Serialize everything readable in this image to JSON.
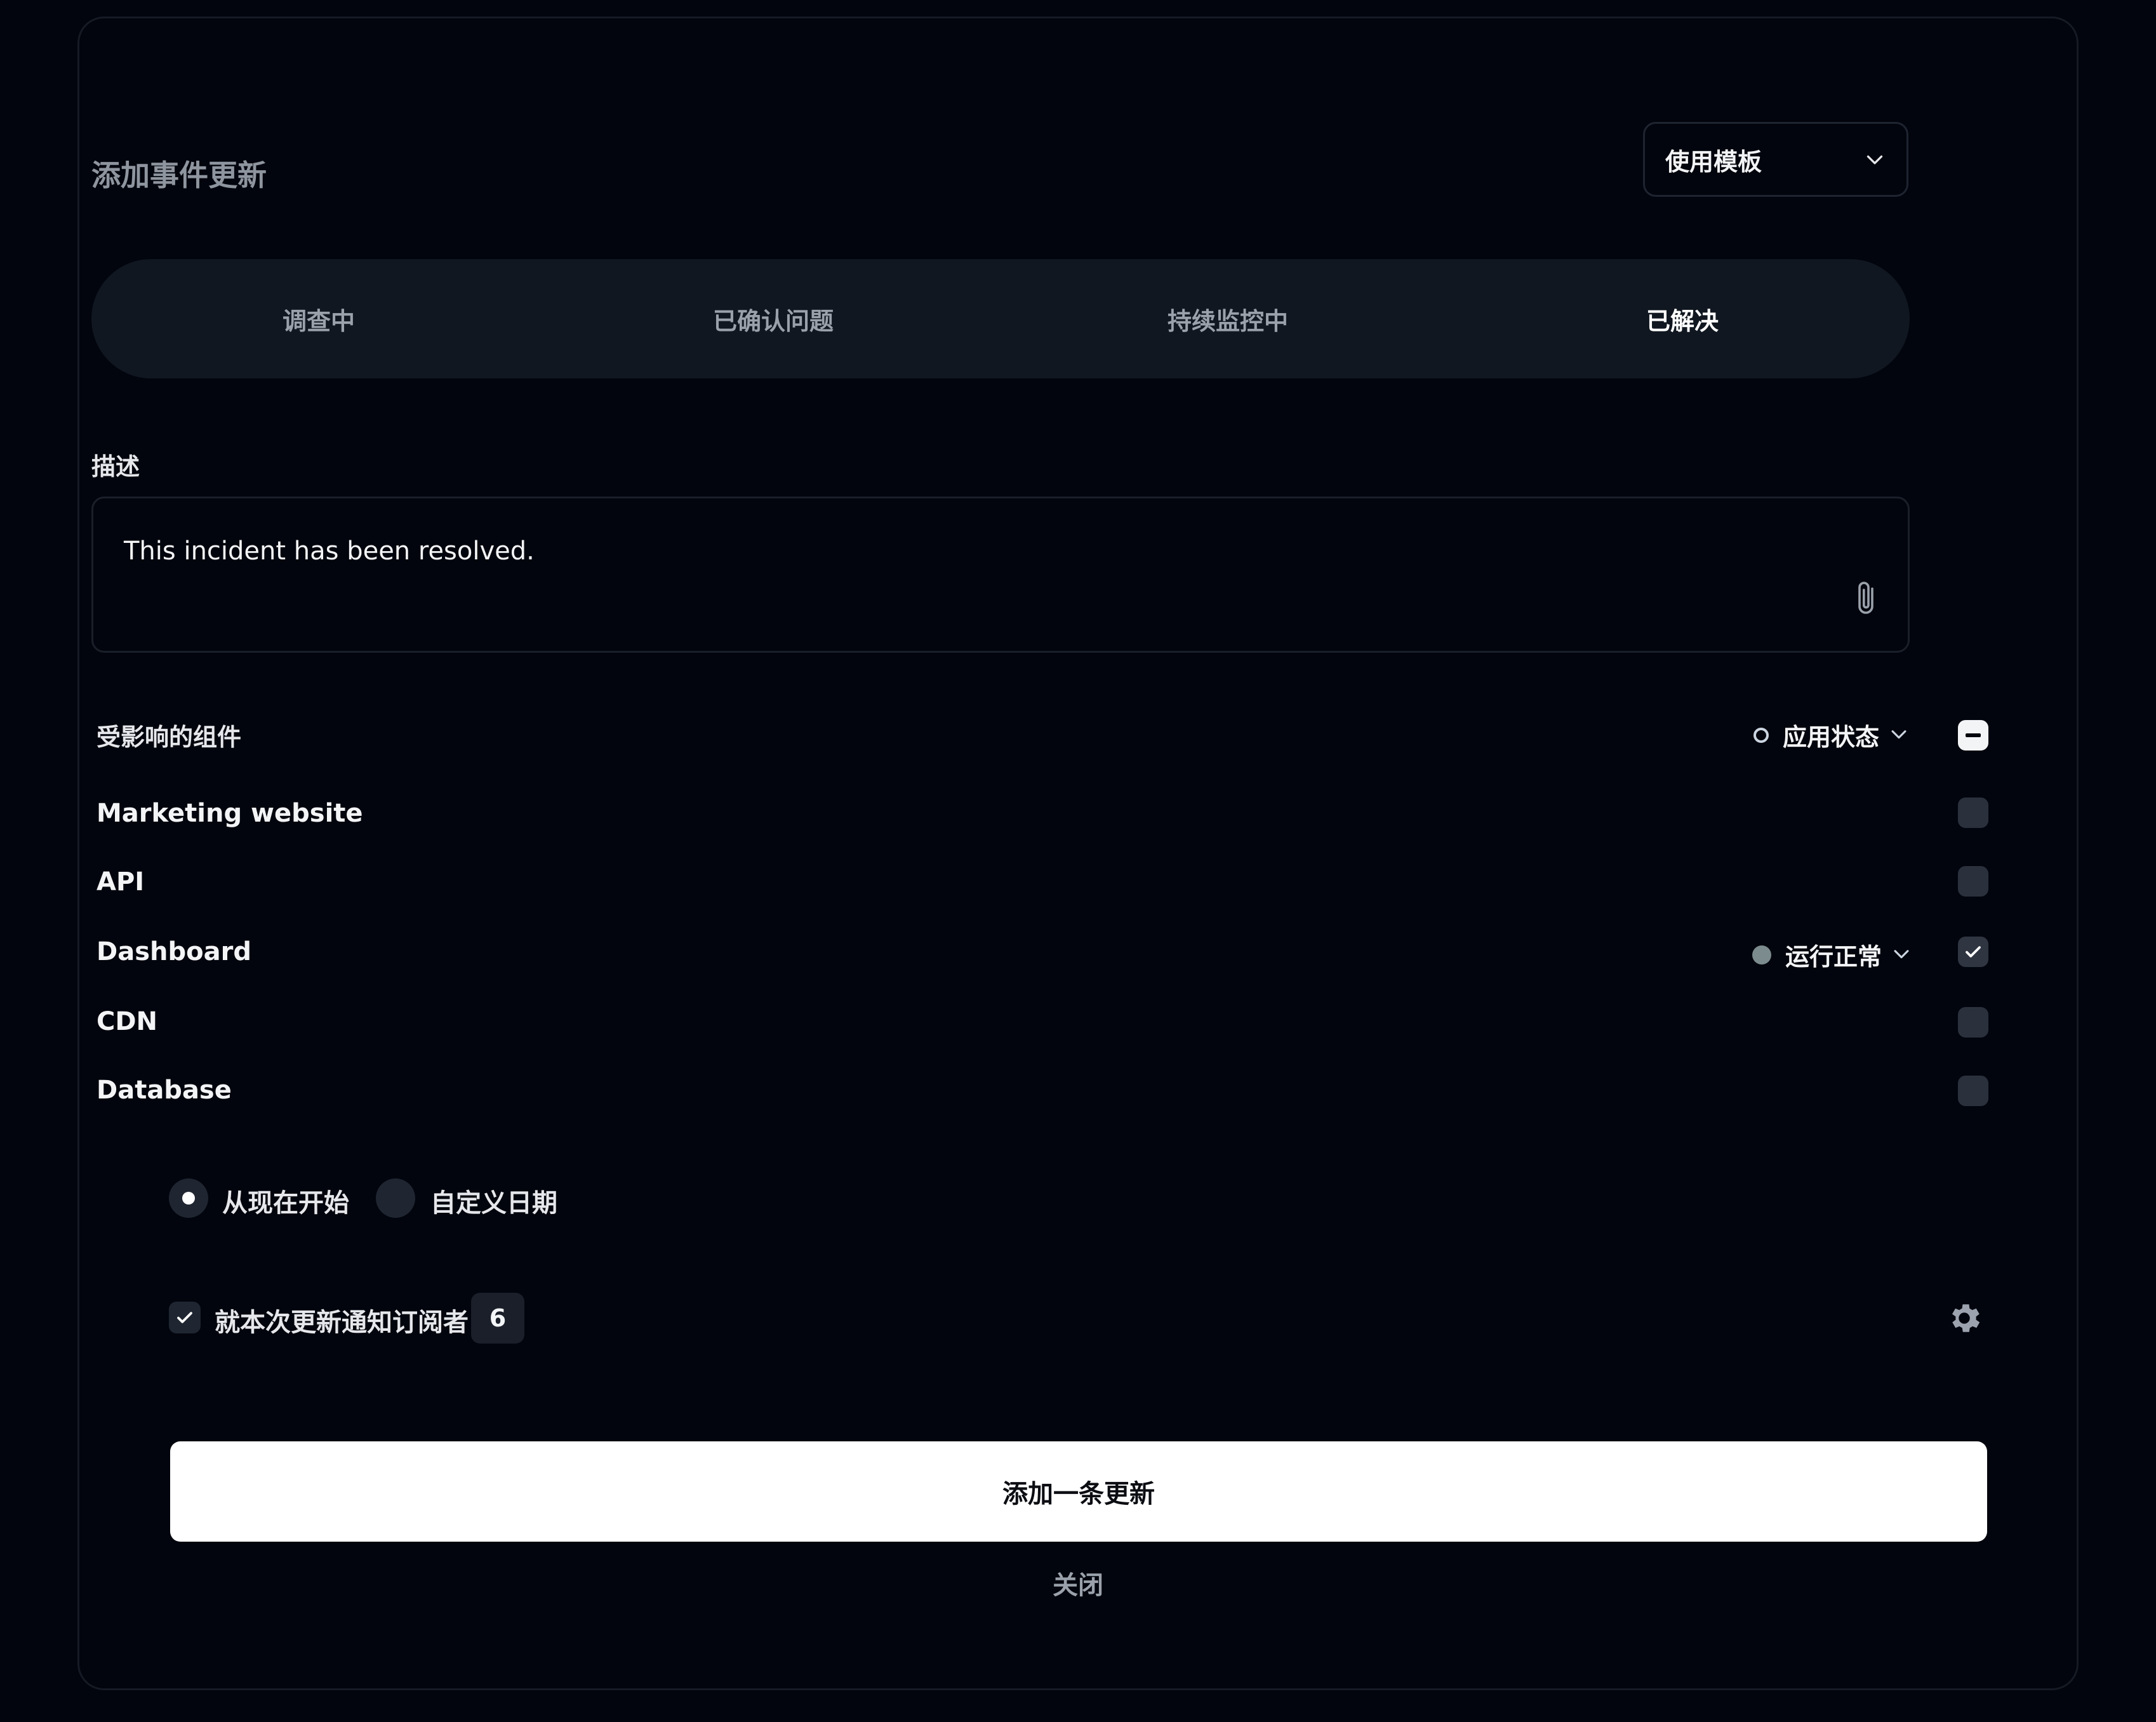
{
  "dialog": {
    "title": "添加事件更新",
    "template_select": {
      "label": "使用模板",
      "icon": "chevron-down-icon"
    }
  },
  "status_tabs": [
    {
      "label": "调查中",
      "active": false
    },
    {
      "label": "已确认问题",
      "active": false
    },
    {
      "label": "持续监控中",
      "active": false
    },
    {
      "label": "已解决",
      "active": true
    }
  ],
  "description": {
    "label": "描述",
    "value": "This incident has been resolved.",
    "attach_icon": "paperclip-icon"
  },
  "components": {
    "header": "受影响的组件",
    "apply_status_label": "应用状态",
    "select_all_state": "indeterminate",
    "items": [
      {
        "name": "Marketing website",
        "checked": false,
        "status": ""
      },
      {
        "name": "API",
        "checked": false,
        "status": ""
      },
      {
        "name": "Dashboard",
        "checked": true,
        "status": "运行正常"
      },
      {
        "name": "CDN",
        "checked": false,
        "status": ""
      },
      {
        "name": "Database",
        "checked": false,
        "status": ""
      }
    ]
  },
  "timing": {
    "options": [
      {
        "label": "从现在开始",
        "selected": true
      },
      {
        "label": "自定义日期",
        "selected": false
      }
    ]
  },
  "notify": {
    "label": "就本次更新通知订阅者",
    "checked": true,
    "count": "6",
    "settings_icon": "gear-icon"
  },
  "actions": {
    "submit_label": "添加一条更新",
    "close_label": "关闭"
  },
  "colors": {
    "background": "#02050d",
    "tab_bar": "#101720",
    "primary_button": "#ffffff",
    "operational_dot": "#7c8b8d"
  }
}
